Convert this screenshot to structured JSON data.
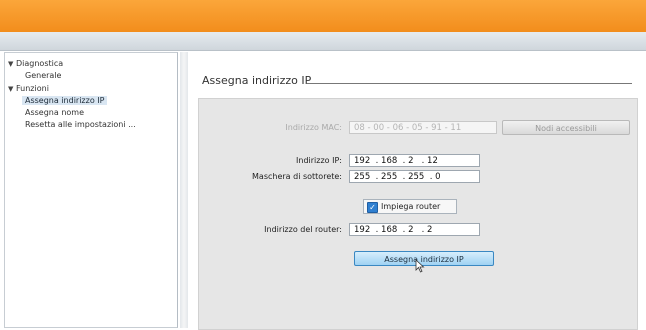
{
  "sidebar": {
    "diagnostica": "Diagnostica",
    "generale": "Generale",
    "funzioni": "Funzioni",
    "assegna_ip": "Assegna indirizzo IP",
    "assegna_nome": "Assegna nome",
    "reset": "Resetta alle impostazioni ..."
  },
  "main": {
    "title": "Assegna indirizzo IP",
    "mac_label": "Indirizzo MAC:",
    "mac_value": "08 - 00 - 06 - 05 - 91 - 11",
    "nodi_button": "Nodi accessibili",
    "ip_label": "Indirizzo IP:",
    "ip": [
      "192",
      "168",
      "2",
      "12"
    ],
    "mask_label": "Maschera di sottorete:",
    "mask": [
      "255",
      "255",
      "255",
      "0"
    ],
    "router_checkbox": "Impiega router",
    "router_label": "Indirizzo del router:",
    "router": [
      "192",
      "168",
      "2",
      "2"
    ],
    "assign_button": "Assegna indirizzo IP"
  },
  "colors": {
    "topbar": "#f89a2a",
    "selected": "#d9e6f2",
    "button_blue": "#9fd2f3"
  }
}
